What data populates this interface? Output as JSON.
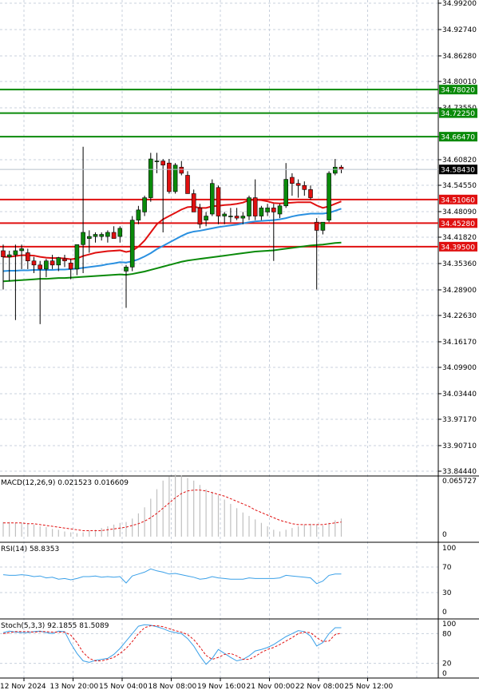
{
  "chart_data": {
    "type": "candlestick",
    "main": {
      "price_axis_labels": [
        "34.99200",
        "34.92740",
        "34.86280",
        "34.80010",
        "34.73550",
        "34.66470",
        "34.60820",
        "34.54550",
        "34.48090",
        "34.41820",
        "34.35360",
        "34.28900",
        "34.22630",
        "34.16170",
        "34.09900",
        "34.03440",
        "33.97170",
        "33.90710",
        "33.84440"
      ],
      "price_range": [
        33.8444,
        34.992
      ],
      "horizontal_levels": [
        {
          "value": 34.7802,
          "label": "34.78020",
          "color": "#0a8a0a"
        },
        {
          "value": 34.7225,
          "label": "34.72250",
          "color": "#0a8a0a"
        },
        {
          "value": 34.6647,
          "label": "34.66470",
          "color": "#0a8a0a"
        },
        {
          "value": 34.5106,
          "label": "34.51060",
          "color": "#e01010"
        },
        {
          "value": 34.4528,
          "label": "34.45280",
          "color": "#e01010"
        },
        {
          "value": 34.395,
          "label": "34.39500",
          "color": "#e01010"
        }
      ],
      "current_price": {
        "value": 34.5843,
        "label": "34.58430"
      },
      "candles": [
        {
          "o": 34.385,
          "h": 34.4,
          "l": 34.29,
          "c": 34.37
        },
        {
          "o": 34.37,
          "h": 34.385,
          "l": 34.31,
          "c": 34.375
        },
        {
          "o": 34.375,
          "h": 34.4,
          "l": 34.215,
          "c": 34.385
        },
        {
          "o": 34.385,
          "h": 34.4,
          "l": 34.34,
          "c": 34.39
        },
        {
          "o": 34.38,
          "h": 34.39,
          "l": 34.34,
          "c": 34.36
        },
        {
          "o": 34.36,
          "h": 34.37,
          "l": 34.33,
          "c": 34.35
        },
        {
          "o": 34.35,
          "h": 34.36,
          "l": 34.205,
          "c": 34.34
        },
        {
          "o": 34.34,
          "h": 34.365,
          "l": 34.32,
          "c": 34.36
        },
        {
          "o": 34.36,
          "h": 34.375,
          "l": 34.34,
          "c": 34.35
        },
        {
          "o": 34.35,
          "h": 34.37,
          "l": 34.335,
          "c": 34.368
        },
        {
          "o": 34.365,
          "h": 34.375,
          "l": 34.345,
          "c": 34.36
        },
        {
          "o": 34.355,
          "h": 34.365,
          "l": 34.315,
          "c": 34.34
        },
        {
          "o": 34.34,
          "h": 34.4,
          "l": 34.325,
          "c": 34.4
        },
        {
          "o": 34.4,
          "h": 34.64,
          "l": 34.33,
          "c": 34.43
        },
        {
          "o": 34.415,
          "h": 34.435,
          "l": 34.38,
          "c": 34.42
        },
        {
          "o": 34.42,
          "h": 34.43,
          "l": 34.405,
          "c": 34.425
        },
        {
          "o": 34.42,
          "h": 34.43,
          "l": 34.41,
          "c": 34.425
        },
        {
          "o": 34.42,
          "h": 34.435,
          "l": 34.405,
          "c": 34.43
        },
        {
          "o": 34.43,
          "h": 34.445,
          "l": 34.415,
          "c": 34.415
        },
        {
          "o": 34.42,
          "h": 34.445,
          "l": 34.405,
          "c": 34.44
        },
        {
          "o": 34.335,
          "h": 34.35,
          "l": 34.245,
          "c": 34.345
        },
        {
          "o": 34.345,
          "h": 34.47,
          "l": 34.335,
          "c": 34.46
        },
        {
          "o": 34.46,
          "h": 34.495,
          "l": 34.45,
          "c": 34.485
        },
        {
          "o": 34.48,
          "h": 34.52,
          "l": 34.47,
          "c": 34.515
        },
        {
          "o": 34.515,
          "h": 34.625,
          "l": 34.505,
          "c": 34.61
        },
        {
          "o": 34.605,
          "h": 34.625,
          "l": 34.575,
          "c": 34.605
        },
        {
          "o": 34.605,
          "h": 34.61,
          "l": 34.43,
          "c": 34.595
        },
        {
          "o": 34.6,
          "h": 34.61,
          "l": 34.525,
          "c": 34.53
        },
        {
          "o": 34.53,
          "h": 34.6,
          "l": 34.525,
          "c": 34.595
        },
        {
          "o": 34.59,
          "h": 34.605,
          "l": 34.57,
          "c": 34.575
        },
        {
          "o": 34.57,
          "h": 34.58,
          "l": 34.525,
          "c": 34.525
        },
        {
          "o": 34.525,
          "h": 34.535,
          "l": 34.48,
          "c": 34.48
        },
        {
          "o": 34.49,
          "h": 34.5,
          "l": 34.44,
          "c": 34.45
        },
        {
          "o": 34.46,
          "h": 34.48,
          "l": 34.445,
          "c": 34.47
        },
        {
          "o": 34.475,
          "h": 34.56,
          "l": 34.47,
          "c": 34.55
        },
        {
          "o": 34.54,
          "h": 34.545,
          "l": 34.45,
          "c": 34.47
        },
        {
          "o": 34.47,
          "h": 34.48,
          "l": 34.45,
          "c": 34.475
        },
        {
          "o": 34.47,
          "h": 34.49,
          "l": 34.455,
          "c": 34.47
        },
        {
          "o": 34.47,
          "h": 34.49,
          "l": 34.46,
          "c": 34.465
        },
        {
          "o": 34.465,
          "h": 34.48,
          "l": 34.45,
          "c": 34.47
        },
        {
          "o": 34.47,
          "h": 34.52,
          "l": 34.46,
          "c": 34.515
        },
        {
          "o": 34.515,
          "h": 34.56,
          "l": 34.46,
          "c": 34.47
        },
        {
          "o": 34.47,
          "h": 34.495,
          "l": 34.46,
          "c": 34.49
        },
        {
          "o": 34.48,
          "h": 34.5,
          "l": 34.47,
          "c": 34.49
        },
        {
          "o": 34.49,
          "h": 34.5,
          "l": 34.36,
          "c": 34.48
        },
        {
          "o": 34.475,
          "h": 34.5,
          "l": 34.465,
          "c": 34.495
        },
        {
          "o": 34.495,
          "h": 34.6,
          "l": 34.49,
          "c": 34.56
        },
        {
          "o": 34.565,
          "h": 34.575,
          "l": 34.52,
          "c": 34.55
        },
        {
          "o": 34.55,
          "h": 34.56,
          "l": 34.515,
          "c": 34.545
        },
        {
          "o": 34.545,
          "h": 34.555,
          "l": 34.52,
          "c": 34.535
        },
        {
          "o": 34.535,
          "h": 34.545,
          "l": 34.51,
          "c": 34.515
        },
        {
          "o": 34.455,
          "h": 34.465,
          "l": 34.29,
          "c": 34.435
        },
        {
          "o": 34.435,
          "h": 34.45,
          "l": 34.425,
          "c": 34.455
        },
        {
          "o": 34.46,
          "h": 34.58,
          "l": 34.455,
          "c": 34.575
        },
        {
          "o": 34.575,
          "h": 34.61,
          "l": 34.57,
          "c": 34.59
        },
        {
          "o": 34.59,
          "h": 34.595,
          "l": 34.575,
          "c": 34.585
        }
      ],
      "ma_red": [
        34.37,
        34.37,
        34.372,
        34.374,
        34.374,
        34.373,
        34.37,
        34.368,
        34.367,
        34.367,
        34.366,
        34.364,
        34.366,
        34.372,
        34.376,
        34.38,
        34.382,
        34.384,
        34.385,
        34.386,
        34.382,
        34.385,
        34.395,
        34.41,
        34.43,
        34.45,
        34.462,
        34.47,
        34.478,
        34.486,
        34.492,
        34.493,
        34.49,
        34.49,
        34.494,
        34.495,
        34.497,
        34.498,
        34.5,
        34.503,
        34.509,
        34.51,
        34.509,
        34.506,
        34.502,
        34.501,
        34.502,
        34.503,
        34.504,
        34.504,
        34.504,
        34.496,
        34.49,
        34.494,
        34.5,
        34.506
      ],
      "ma_blue": [
        34.335,
        34.336,
        34.336,
        34.337,
        34.337,
        34.338,
        34.338,
        34.338,
        34.338,
        34.339,
        34.339,
        34.34,
        34.341,
        34.343,
        34.345,
        34.347,
        34.349,
        34.352,
        34.354,
        34.357,
        34.356,
        34.359,
        34.364,
        34.371,
        34.379,
        34.389,
        34.397,
        34.405,
        34.413,
        34.421,
        34.428,
        34.432,
        34.434,
        34.437,
        34.44,
        34.443,
        34.445,
        34.447,
        34.449,
        34.452,
        34.455,
        34.457,
        34.458,
        34.459,
        34.46,
        34.462,
        34.465,
        34.469,
        34.472,
        34.474,
        34.476,
        34.476,
        34.476,
        34.478,
        34.483,
        34.488
      ],
      "ma_green": [
        34.31,
        34.311,
        34.312,
        34.313,
        34.314,
        34.315,
        34.316,
        34.316,
        34.317,
        34.318,
        34.318,
        34.319,
        34.32,
        34.321,
        34.322,
        34.323,
        34.324,
        34.325,
        34.326,
        34.327,
        34.326,
        34.328,
        34.331,
        34.334,
        34.338,
        34.342,
        34.346,
        34.35,
        34.354,
        34.358,
        34.361,
        34.363,
        34.365,
        34.367,
        34.369,
        34.371,
        34.373,
        34.375,
        34.377,
        34.379,
        34.381,
        34.383,
        34.384,
        34.385,
        34.386,
        34.388,
        34.39,
        34.392,
        34.394,
        34.396,
        34.398,
        34.399,
        34.4,
        34.402,
        34.404,
        34.405
      ]
    },
    "macd": {
      "label": "MACD(12,26,9) 0.021523 0.016609",
      "axis_labels": [
        "0.065727",
        "0"
      ],
      "range": [
        0,
        0.065727
      ],
      "histogram": [
        0.017,
        0.017,
        0.016,
        0.016,
        0.015,
        0.014,
        0.012,
        0.011,
        0.009,
        0.008,
        0.006,
        0.005,
        0.004,
        0.005,
        0.007,
        0.008,
        0.01,
        0.012,
        0.014,
        0.016,
        0.017,
        0.021,
        0.027,
        0.034,
        0.044,
        0.055,
        0.065,
        0.07,
        0.072,
        0.071,
        0.068,
        0.065,
        0.06,
        0.055,
        0.052,
        0.048,
        0.043,
        0.038,
        0.033,
        0.028,
        0.024,
        0.02,
        0.016,
        0.012,
        0.008,
        0.006,
        0.008,
        0.01,
        0.012,
        0.014,
        0.015,
        0.014,
        0.013,
        0.016,
        0.019,
        0.021
      ],
      "signal": [
        0.016,
        0.016,
        0.016,
        0.016,
        0.015,
        0.015,
        0.014,
        0.013,
        0.012,
        0.011,
        0.01,
        0.009,
        0.008,
        0.007,
        0.007,
        0.007,
        0.007,
        0.008,
        0.009,
        0.01,
        0.011,
        0.013,
        0.015,
        0.018,
        0.022,
        0.027,
        0.033,
        0.039,
        0.045,
        0.05,
        0.053,
        0.054,
        0.054,
        0.053,
        0.051,
        0.049,
        0.047,
        0.044,
        0.041,
        0.038,
        0.035,
        0.031,
        0.028,
        0.025,
        0.022,
        0.019,
        0.017,
        0.015,
        0.014,
        0.014,
        0.014,
        0.014,
        0.014,
        0.015,
        0.016,
        0.017
      ]
    },
    "rsi": {
      "label": "RSI(14) 58.8353",
      "axis_labels": [
        "100",
        "70",
        "30",
        "0"
      ],
      "range": [
        0,
        100
      ],
      "values": [
        58,
        57,
        57,
        58,
        57,
        55,
        56,
        53,
        54,
        51,
        52,
        50,
        52,
        55,
        55,
        56,
        54,
        55,
        54,
        55,
        45,
        56,
        59,
        62,
        67,
        64,
        62,
        59,
        60,
        58,
        56,
        54,
        51,
        52,
        55,
        53,
        52,
        51,
        51,
        51,
        53,
        52,
        52,
        52,
        52,
        53,
        57,
        56,
        55,
        54,
        53,
        44,
        48,
        57,
        59,
        59
      ]
    },
    "stoch": {
      "label": "Stoch(5,3,3) 92.1855 81.5089",
      "axis_labels": [
        "100",
        "80",
        "20",
        "0"
      ],
      "range": [
        0,
        100
      ],
      "k": [
        82,
        85,
        83,
        82,
        82,
        84,
        85,
        82,
        80,
        85,
        84,
        60,
        40,
        25,
        22,
        26,
        28,
        30,
        38,
        50,
        65,
        80,
        95,
        98,
        97,
        94,
        90,
        85,
        82,
        80,
        70,
        55,
        35,
        18,
        30,
        48,
        40,
        32,
        25,
        28,
        35,
        45,
        48,
        52,
        58,
        66,
        74,
        80,
        86,
        84,
        75,
        55,
        62,
        80,
        92,
        92
      ],
      "d": [
        80,
        82,
        84,
        84,
        84,
        83,
        84,
        84,
        83,
        83,
        83,
        77,
        62,
        42,
        30,
        25,
        25,
        28,
        32,
        40,
        50,
        64,
        80,
        92,
        96,
        96,
        94,
        90,
        86,
        83,
        78,
        68,
        53,
        36,
        28,
        32,
        38,
        40,
        35,
        28,
        28,
        34,
        42,
        48,
        52,
        58,
        65,
        72,
        80,
        83,
        82,
        72,
        64,
        65,
        78,
        81
      ]
    },
    "x_axis_labels": [
      "12 Nov 2024",
      "13 Nov 20:00",
      "15 Nov 04:00",
      "18 Nov 08:00",
      "19 Nov 16:00",
      "21 Nov 00:00",
      "22 Nov 08:00",
      "25 Nov 12:00"
    ],
    "colors": {
      "bull": "#0a8a0a",
      "bear": "#e01010",
      "ma_red": "#e01010",
      "ma_blue": "#2a90e0",
      "ma_green": "#0a8a0a",
      "grid": "#c8d0dc",
      "indicator_line": "#3aa0e8",
      "indicator_dash": "#e01010",
      "histogram": "#c0c0c0"
    }
  }
}
